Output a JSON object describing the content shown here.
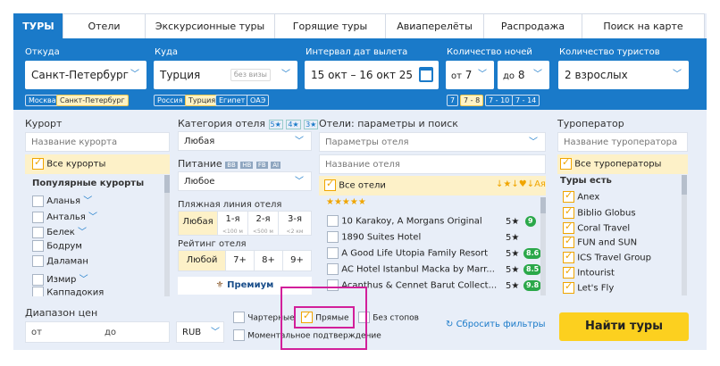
{
  "tabs": [
    "ТУРЫ",
    "Отели",
    "Экскурсионные туры",
    "Горящие туры",
    "Авиаперелёты",
    "Распродажа",
    "Поиск на карте"
  ],
  "header": {
    "from_label": "Откуда",
    "from_value": "Санкт-Петербург",
    "to_label": "Куда",
    "to_value": "Турция",
    "to_badge": "без визы",
    "dates_label": "Интервал дат вылета",
    "dates_value": "15 окт – 16 окт 25",
    "nights_label": "Количество ночей",
    "nights_from_prefix": "от",
    "nights_from": "7",
    "nights_to_prefix": "до",
    "nights_to": "8",
    "tourists_label": "Количество туристов",
    "tourists_value": "2 взрослых",
    "from_chips": [
      "Москва",
      "Санкт-Петербург"
    ],
    "to_chips": [
      "Россия",
      "Турция",
      "Египет",
      "ОАЭ"
    ],
    "nights_chips": [
      "7",
      "7 - 8",
      "7 - 10",
      "7 - 14"
    ]
  },
  "resort": {
    "label": "Курорт",
    "placeholder": "Название курорта",
    "all": "Все курорты",
    "popular": "Популярные курорты",
    "items": [
      "Аланья",
      "Анталья",
      "Белек",
      "Бодрум",
      "Даламан",
      "Измир",
      "Каппадокия"
    ]
  },
  "category": {
    "label": "Категория отеля",
    "badges": [
      "5★",
      "4★",
      "3★"
    ],
    "value": "Любая",
    "food_label": "Питание",
    "food_badges": [
      "BB",
      "HB",
      "FB",
      "AI"
    ],
    "food_value": "Любое",
    "beach_label": "Пляжная линия отеля",
    "beach": [
      {
        "t": "Любая",
        "s": ""
      },
      {
        "t": "1-я",
        "s": "<100 м"
      },
      {
        "t": "2-я",
        "s": "<500 м"
      },
      {
        "t": "3-я",
        "s": "<2 км"
      }
    ],
    "rating_label": "Рейтинг отеля",
    "rating": [
      "Любой",
      "7+",
      "8+",
      "9+"
    ],
    "premium": "Премиум"
  },
  "hotels": {
    "label": "Отели: параметры и поиск",
    "params_placeholder": "Параметры отеля",
    "name_placeholder": "Название отеля",
    "all": "Все отели",
    "sort_icons": "↓★↓♥↓Ая",
    "items": [
      {
        "name": "10 Karakoy, A Morgans Original",
        "stars": "5★",
        "score": "9",
        "color": "#2ba84a"
      },
      {
        "name": "1890 Suites Hotel",
        "stars": "5★",
        "score": "",
        "color": ""
      },
      {
        "name": "A Good Life Utopia Family Resort",
        "stars": "5★",
        "score": "8.6",
        "color": "#2ba84a"
      },
      {
        "name": "AC Hotel Istanbul Macka by Marr...",
        "stars": "5★",
        "score": "8.5",
        "color": "#2ba84a"
      },
      {
        "name": "Acanthus & Cennet Barut Collect...",
        "stars": "5★",
        "score": "9.8",
        "color": "#2ba84a"
      }
    ]
  },
  "operator": {
    "label": "Туроператор",
    "placeholder": "Название туроператора",
    "all": "Все туроператоры",
    "have": "Туры есть",
    "items": [
      "Anex",
      "Biblio Globus",
      "Coral Travel",
      "FUN and SUN",
      "ICS Travel Group",
      "Intourist",
      "Let's Fly"
    ]
  },
  "bottom": {
    "price_label": "Диапазон цен",
    "from": "от",
    "to": "до",
    "currency": "RUB",
    "charter": "Чартерные",
    "direct": "Прямые",
    "nostop": "Без стопов",
    "instant": "Моментальное подтверждение",
    "reset": "Сбросить фильтры",
    "find": "Найти туры"
  }
}
